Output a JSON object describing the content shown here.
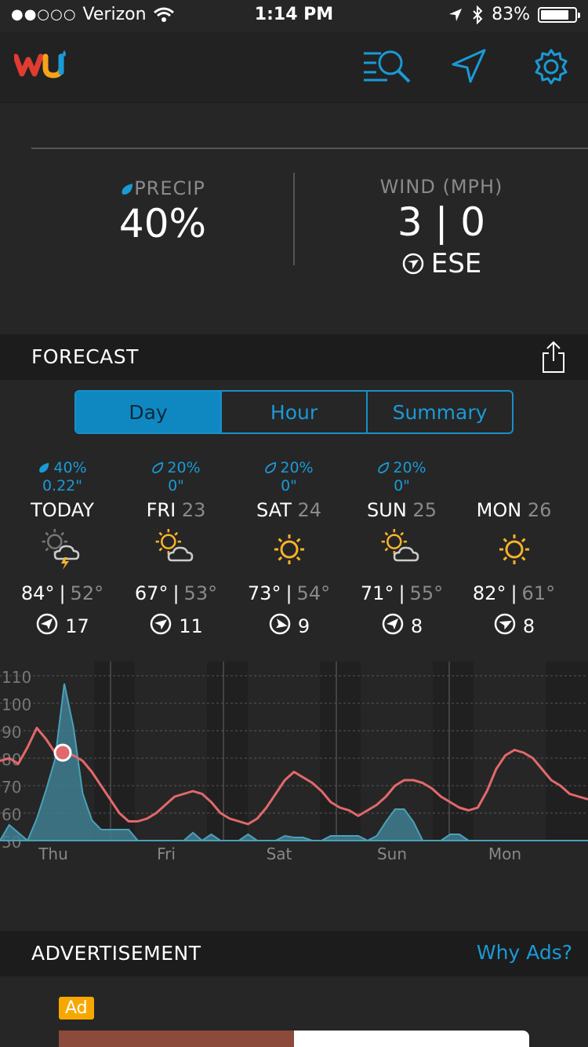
{
  "status": {
    "carrier": "Verizon",
    "time": "1:14 PM",
    "battery": "83%",
    "battery_level": 0.83
  },
  "current": {
    "precip_label": "PRECIP",
    "precip_value": "40%",
    "wind_label": "WIND (MPH)",
    "wind_value": "3 | 0",
    "wind_dir": "ESE"
  },
  "forecast": {
    "title": "FORECAST",
    "tabs": [
      "Day",
      "Hour",
      "Summary"
    ],
    "active_tab": "Day",
    "days": [
      {
        "pct": "40%",
        "amt": "0.22\"",
        "day": "TODAY",
        "num": "",
        "icon": "thunderstorm-icon",
        "hi": "84°",
        "lo": "52°",
        "wind": "17"
      },
      {
        "pct": "20%",
        "amt": "0\"",
        "day": "FRI",
        "num": "23",
        "icon": "partly-cloudy-icon",
        "hi": "67°",
        "lo": "53°",
        "wind": "11"
      },
      {
        "pct": "20%",
        "amt": "0\"",
        "day": "SAT",
        "num": "24",
        "icon": "sunny-icon",
        "hi": "73°",
        "lo": "54°",
        "wind": "9"
      },
      {
        "pct": "20%",
        "amt": "0\"",
        "day": "SUN",
        "num": "25",
        "icon": "partly-cloudy-icon",
        "hi": "71°",
        "lo": "55°",
        "wind": "8"
      },
      {
        "pct": "",
        "amt": "",
        "day": "MON",
        "num": "26",
        "icon": "sunny-icon",
        "hi": "82°",
        "lo": "61°",
        "wind": "8"
      }
    ]
  },
  "chart_data": {
    "type": "line",
    "y_ticks": [
      "110",
      "100",
      "90",
      "80",
      "70",
      "60",
      "50"
    ],
    "x_labels": [
      "Thu",
      "Fri",
      "Sat",
      "Sun",
      "Mon"
    ],
    "ylim": [
      50,
      110
    ],
    "series": [
      {
        "values": [
          79,
          80,
          78,
          84,
          91,
          87,
          82,
          82,
          81,
          79,
          75,
          70,
          65,
          60,
          57,
          57,
          58,
          60,
          63,
          66,
          67,
          68,
          67,
          64,
          60,
          58,
          57,
          56,
          58,
          62,
          67,
          72,
          75,
          73,
          71,
          68,
          64,
          62,
          61,
          59,
          61,
          63,
          66,
          70,
          72,
          72,
          71,
          69,
          66,
          64,
          62,
          61,
          62,
          68,
          76,
          81,
          83,
          82,
          80,
          76,
          72,
          70,
          67,
          66,
          65
        ]
      }
    ],
    "precip_series": [
      0,
      10,
      5,
      0,
      14,
      32,
      52,
      100,
      72,
      30,
      13,
      7,
      7,
      7,
      7,
      0,
      0,
      0,
      0,
      0,
      0,
      5,
      0,
      4,
      0,
      0,
      0,
      4,
      0,
      0,
      0,
      3,
      2,
      2,
      0,
      0,
      3,
      3,
      3,
      3,
      0,
      3,
      12,
      20,
      20,
      12,
      0,
      0,
      0,
      4,
      4,
      0,
      0,
      0,
      0,
      0,
      0,
      0,
      0,
      0,
      0,
      0,
      0,
      0,
      0
    ],
    "colors": {
      "temp": "#e2696b",
      "precip": "#3f7e90",
      "marker": "#e2696b"
    }
  },
  "ads": {
    "title": "ADVERTISEMENT",
    "why": "Why Ads?",
    "badge": "Ad"
  }
}
